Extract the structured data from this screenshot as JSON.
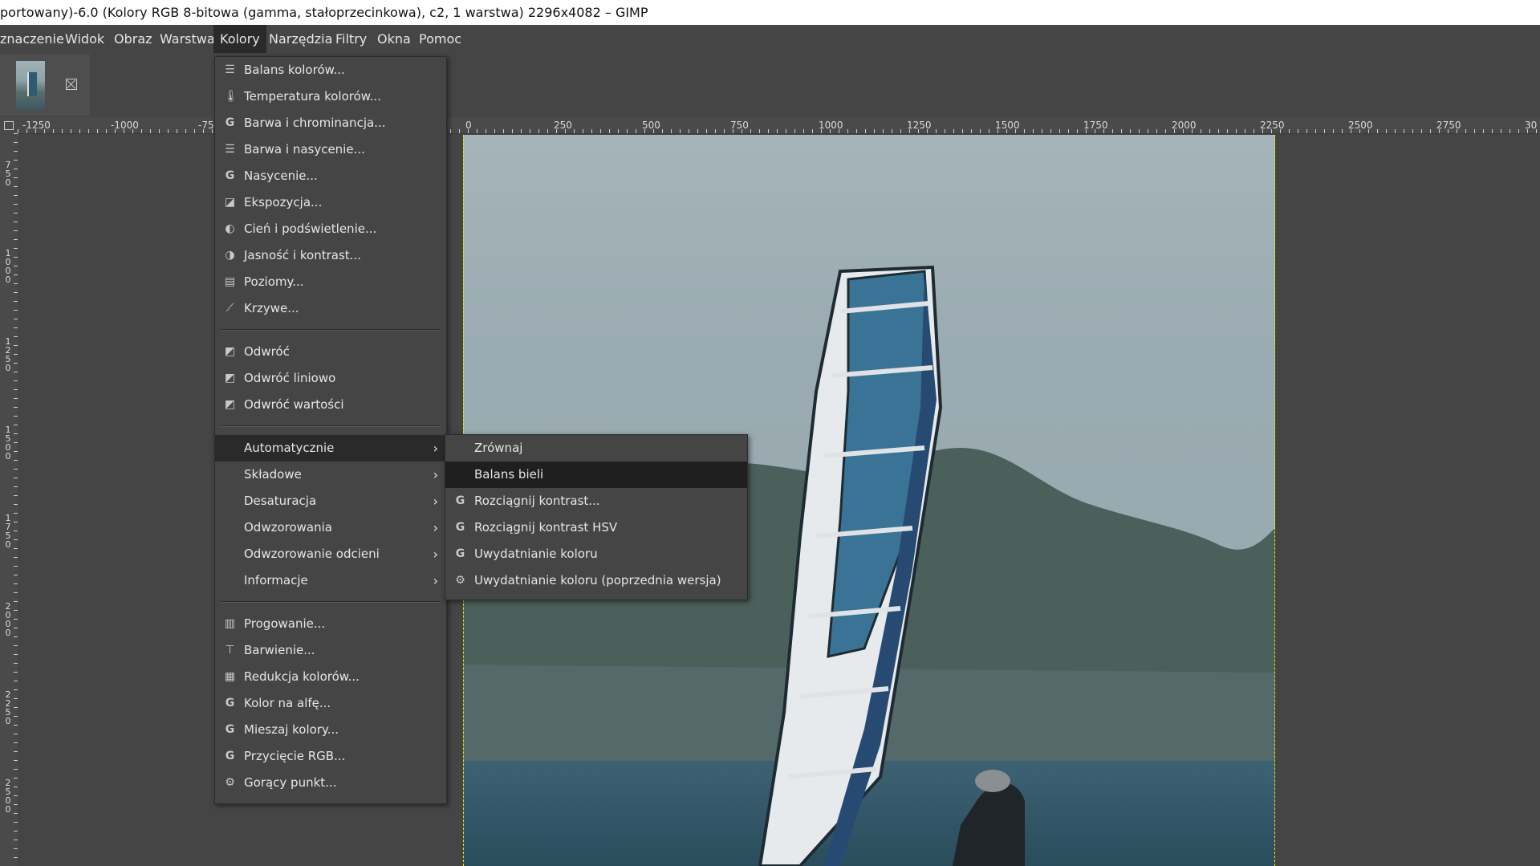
{
  "window": {
    "title": "portowany)-6.0 (Kolory RGB 8-bitowa (gamma, stałoprzecinkowa), c2, 1 warstwa) 2296x4082 – GIMP"
  },
  "menubar": {
    "items": [
      {
        "label": "znaczenie"
      },
      {
        "label": "Widok"
      },
      {
        "label": "Obraz"
      },
      {
        "label": "Warstwa"
      },
      {
        "label": "Kolory"
      },
      {
        "label": "Narzędzia"
      },
      {
        "label": "Filtry"
      },
      {
        "label": "Okna"
      },
      {
        "label": "Pomoc"
      }
    ],
    "active": "Kolory"
  },
  "ruler": {
    "h_labels": [
      "-1250",
      "-1000",
      "-75",
      "0",
      "250",
      "500",
      "750",
      "1000",
      "1250",
      "1500",
      "1750",
      "2000",
      "2250",
      "2500",
      "2750",
      "30"
    ],
    "v_labels": [
      "750",
      "1000",
      "1250",
      "1500",
      "1750",
      "2000",
      "2250",
      "2500"
    ]
  },
  "colors_menu": {
    "items": [
      {
        "label": "Balans kolorów...",
        "icon": "sliders-icon"
      },
      {
        "label": "Temperatura kolorów...",
        "icon": "thermometer-icon"
      },
      {
        "label": "Barwa i chrominancja...",
        "icon": "gegl-icon"
      },
      {
        "label": "Barwa i nasycenie...",
        "icon": "sliders-icon"
      },
      {
        "label": "Nasycenie...",
        "icon": "gegl-icon"
      },
      {
        "label": "Ekspozycja...",
        "icon": "exposure-icon"
      },
      {
        "label": "Cień i podświetlenie...",
        "icon": "shadow-icon"
      },
      {
        "label": "Jasność i kontrast...",
        "icon": "contrast-icon"
      },
      {
        "label": "Poziomy...",
        "icon": "levels-icon"
      },
      {
        "label": "Krzywe...",
        "icon": "curves-icon"
      },
      {
        "label": "Odwróć",
        "icon": "invert-icon"
      },
      {
        "label": "Odwróć liniowo",
        "icon": "invert-icon"
      },
      {
        "label": "Odwróć wartości",
        "icon": "invert-icon"
      },
      {
        "label": "Automatycznie",
        "has_submenu": true
      },
      {
        "label": "Składowe",
        "has_submenu": true
      },
      {
        "label": "Desaturacja",
        "has_submenu": true
      },
      {
        "label": "Odwzorowania",
        "has_submenu": true
      },
      {
        "label": "Odwzorowanie odcieni",
        "has_submenu": true
      },
      {
        "label": "Informacje",
        "has_submenu": true
      },
      {
        "label": "Progowanie...",
        "icon": "threshold-icon"
      },
      {
        "label": "Barwienie...",
        "icon": "colorize-icon"
      },
      {
        "label": "Redukcja kolorów...",
        "icon": "posterize-icon"
      },
      {
        "label": "Kolor na alfę...",
        "icon": "gegl-icon"
      },
      {
        "label": "Mieszaj kolory...",
        "icon": "gegl-icon"
      },
      {
        "label": "Przycięcie RGB...",
        "icon": "gegl-icon"
      },
      {
        "label": "Gorący punkt...",
        "icon": "plugin-icon"
      }
    ],
    "highlighted": "Automatycznie"
  },
  "auto_submenu": {
    "items": [
      {
        "label": "Zrównaj",
        "icon": ""
      },
      {
        "label": "Balans bieli",
        "icon": ""
      },
      {
        "label": "Rozciągnij kontrast...",
        "icon": "gegl-icon"
      },
      {
        "label": "Rozciągnij kontrast HSV",
        "icon": "gegl-icon"
      },
      {
        "label": "Uwydatnianie koloru",
        "icon": "gegl-icon"
      },
      {
        "label": "Uwydatnianie koloru (poprzednia wersja)",
        "icon": "plugin-icon"
      }
    ],
    "highlighted": "Balans bieli"
  },
  "colors": {
    "menu_bg": "#454545",
    "highlight_bg": "#2a2a2a",
    "canvas_bg": "#454545",
    "selection_boundary": "#e8e800"
  }
}
